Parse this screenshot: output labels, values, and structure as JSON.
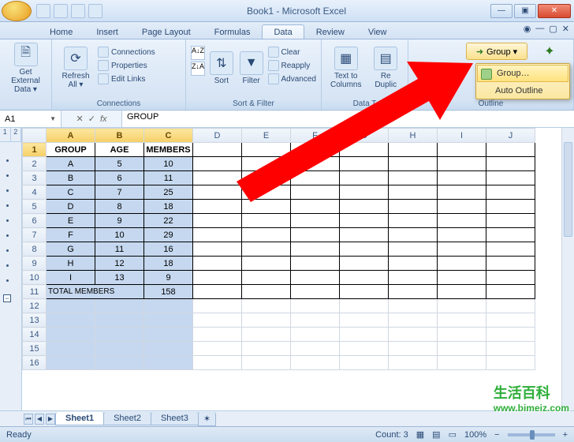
{
  "window": {
    "title": "Book1 - Microsoft Excel"
  },
  "tabs": {
    "items": [
      "Home",
      "Insert",
      "Page Layout",
      "Formulas",
      "Data",
      "Review",
      "View"
    ],
    "active_index": 4
  },
  "ribbon": {
    "get_external": {
      "label": "Get External\nData ▾"
    },
    "refresh": {
      "label": "Refresh\nAll ▾"
    },
    "connections_group": {
      "connections": "Connections",
      "properties": "Properties",
      "edit_links": "Edit Links",
      "group_label": "Connections"
    },
    "sort_filter": {
      "sort": "Sort",
      "filter": "Filter",
      "clear": "Clear",
      "reapply": "Reapply",
      "advanced": "Advanced",
      "group_label": "Sort & Filter"
    },
    "data_tools": {
      "text_to_columns": "Text to\nColumns",
      "remove_dup": "Re\nDuplic",
      "group_label": "Data T"
    },
    "outline": {
      "group_btn": "Group ▾",
      "menu_group": "Group…",
      "menu_auto": "Auto Outline",
      "group_label": "Outline"
    }
  },
  "name_box": {
    "value": "A1"
  },
  "formula_bar": {
    "value": "GROUP"
  },
  "columns": [
    "A",
    "B",
    "C",
    "D",
    "E",
    "F",
    "G",
    "H",
    "I",
    "J"
  ],
  "selected_cols": [
    "A",
    "B",
    "C"
  ],
  "outline_levels": [
    "1",
    "2"
  ],
  "spreadsheet": {
    "headers": [
      "GROUP",
      "AGE",
      "MEMBERS"
    ],
    "rows": [
      {
        "r": 2,
        "c": [
          "A",
          "5",
          "10"
        ]
      },
      {
        "r": 3,
        "c": [
          "B",
          "6",
          "11"
        ]
      },
      {
        "r": 4,
        "c": [
          "C",
          "7",
          "25"
        ]
      },
      {
        "r": 5,
        "c": [
          "D",
          "8",
          "18"
        ]
      },
      {
        "r": 6,
        "c": [
          "E",
          "9",
          "22"
        ]
      },
      {
        "r": 7,
        "c": [
          "F",
          "10",
          "29"
        ]
      },
      {
        "r": 8,
        "c": [
          "G",
          "11",
          "16"
        ]
      },
      {
        "r": 9,
        "c": [
          "H",
          "12",
          "18"
        ]
      },
      {
        "r": 10,
        "c": [
          "I",
          "13",
          "9"
        ]
      }
    ],
    "total_row": {
      "r": 11,
      "label": "TOTAL MEMBERS",
      "value": "158"
    },
    "blank_rows": [
      12,
      13,
      14,
      15,
      16
    ]
  },
  "sheet_tabs": {
    "items": [
      "Sheet1",
      "Sheet2",
      "Sheet3"
    ],
    "active_index": 0
  },
  "status": {
    "left": "Ready",
    "count": "Count: 3",
    "zoom": "100%"
  },
  "watermark": {
    "text": "生活百科",
    "url": "www.bimeiz.com"
  }
}
